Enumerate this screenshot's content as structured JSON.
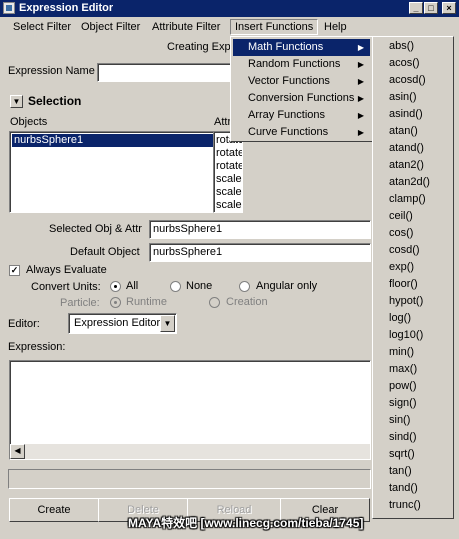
{
  "window": {
    "title": "Expression Editor",
    "btn_min": "_",
    "btn_max": "□",
    "btn_close": "×"
  },
  "menubar": [
    "Select Filter",
    "Object Filter",
    "Attribute Filter",
    "Insert Functions",
    "Help"
  ],
  "header": {
    "creating_label": "Creating Expr"
  },
  "expression_name": {
    "label": "Expression Name",
    "value": ""
  },
  "selection": {
    "label": "Selection",
    "objects_header": "Objects",
    "attributes_header": "Attr",
    "objects": [
      "nurbsSphere1"
    ],
    "attributes": [
      "rotateX",
      "rotateY",
      "rotateZ",
      "scaleX",
      "scaleY",
      "scaleZ"
    ]
  },
  "selected_obj_attr": {
    "label": "Selected Obj & Attr",
    "value": "nurbsSphere1"
  },
  "default_object": {
    "label": "Default Object",
    "value": "nurbsSphere1"
  },
  "always_evaluate": {
    "label": "Always Evaluate",
    "checked": true
  },
  "convert_units": {
    "label": "Convert Units:",
    "options": [
      "All",
      "None",
      "Angular only"
    ],
    "selected": "All"
  },
  "particle": {
    "label": "Particle:",
    "options": [
      "Runtime",
      "Creation"
    ],
    "selected": "Runtime"
  },
  "editor": {
    "label": "Editor:",
    "value": "Expression Editor"
  },
  "expression": {
    "label": "Expression:",
    "text": ""
  },
  "buttons": {
    "create": "Create",
    "delete": "Delete",
    "reload": "Reload",
    "clear": "Clear"
  },
  "insert_menu": {
    "items": [
      "Math Functions",
      "Random Functions",
      "Vector Functions",
      "Conversion Functions",
      "Array Functions",
      "Curve Functions"
    ],
    "active": "Math Functions",
    "submenu_arrow": "▶"
  },
  "math_functions": [
    "abs()",
    "acos()",
    "acosd()",
    "asin()",
    "asind()",
    "atan()",
    "atand()",
    "atan2()",
    "atan2d()",
    "clamp()",
    "ceil()",
    "cos()",
    "cosd()",
    "exp()",
    "floor()",
    "hypot()",
    "log()",
    "log10()",
    "min()",
    "max()",
    "pow()",
    "sign()",
    "sin()",
    "sind()",
    "sqrt()",
    "tan()",
    "tand()",
    "trunc()"
  ],
  "watermark": "MAYA特效吧 [www.linecg.com/tieba/1745]"
}
